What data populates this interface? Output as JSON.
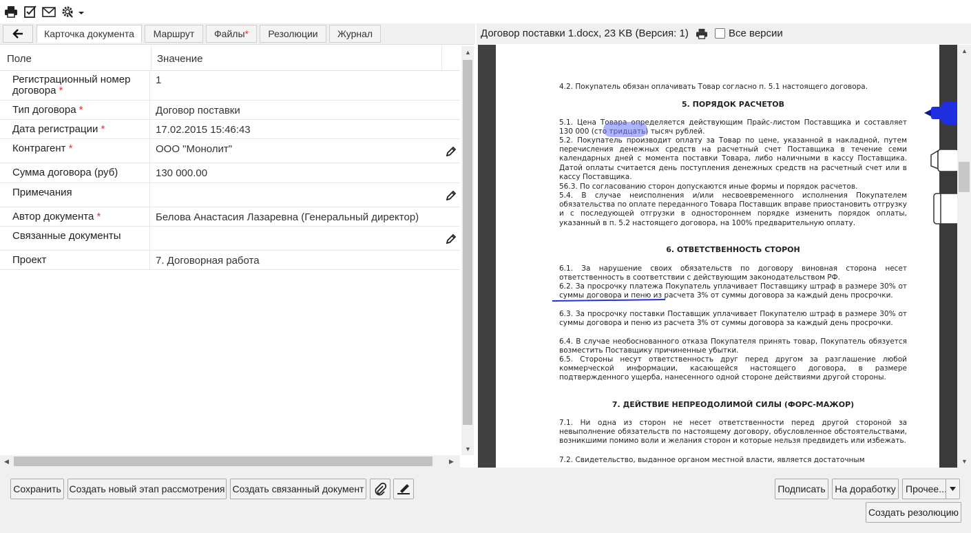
{
  "toolbar": {
    "icons": [
      "printer-icon",
      "checklist-icon",
      "envelope-icon",
      "gear-settings-icon",
      "chevron-down-icon"
    ]
  },
  "tabs": [
    {
      "label": "Карточка документа",
      "active": true
    },
    {
      "label": "Маршрут",
      "active": false
    },
    {
      "label": "Файлы",
      "marker": "*",
      "active": false
    },
    {
      "label": "Резолюции",
      "active": false
    },
    {
      "label": "Журнал",
      "active": false
    }
  ],
  "grid": {
    "col_field": "Поле",
    "col_value": "Значение",
    "rows": [
      {
        "field": "Регистрационный номер договора",
        "required": "*",
        "value": "1",
        "editable": false
      },
      {
        "field": "Тип договора",
        "required": "*",
        "value": "Договор поставки",
        "editable": false
      },
      {
        "field": "Дата регистрации",
        "required": "*",
        "value": "17.02.2015 15:46:43",
        "editable": false
      },
      {
        "field": "Контрагент",
        "required": "*",
        "value": "ООО \"Монолит\"",
        "editable": true
      },
      {
        "field": "Сумма договора (руб)",
        "required": "",
        "value": "130 000.00",
        "editable": false
      },
      {
        "field": "Примечания",
        "required": "",
        "value": "",
        "editable": true
      },
      {
        "field": "Автор документа",
        "required": "*",
        "value": "Белова Анастасия Лазаревна (Генеральный директор)",
        "editable": false
      },
      {
        "field": "Связанные документы",
        "required": "",
        "value": "",
        "editable": true
      },
      {
        "field": "Проект",
        "required": "",
        "value": "7. Договорная работа",
        "editable": false
      }
    ]
  },
  "document": {
    "title": "Договор поставки 1.docx, 23 KB (Версия: 1)",
    "all_versions_label": "Все версии",
    "all_versions_checked": false,
    "content": [
      {
        "type": "p",
        "text": "4.2. Покупатель обязан оплачивать Товар согласно п. 5.1 настоящего договора."
      },
      {
        "type": "h",
        "text": "5. ПОРЯДОК РАСЧЕТОВ"
      },
      {
        "type": "p",
        "text": "5.1. Цена Товара определяется действующим Прайс-листом Поставщика и составляет 130 000 (сто тридцать) тысяч рублей."
      },
      {
        "type": "p",
        "text": "5.2. Покупатель производит оплату за Товар по цене, указанной в накладной, путем перечисления денежных средств на расчетный счет Поставщика в течение семи календарных дней с момента поставки Товара, либо наличными в кассу Поставщика. Датой оплаты считается день поступления денежных средств на расчетный счет или в кассу Поставщика."
      },
      {
        "type": "p",
        "text": "56.3. По согласованию сторон допускаются иные формы и порядок расчетов."
      },
      {
        "type": "p",
        "text": "5.4. В случае неисполнения и/или несвоевременного исполнения Покупателем обязательства по оплате переданного Товара Поставщик вправе приостановить отгрузку и с последующей отгрузки в одностороннем порядке изменить порядок оплаты, указанный в п. 5.2 настоящего договора, на 100% предварительную оплату."
      },
      {
        "type": "h",
        "text": "6. ОТВЕТСТВЕННОСТЬ СТОРОН"
      },
      {
        "type": "p",
        "text": "6.1. За нарушение своих обязательств по договору виновная сторона несет ответственность в соответствии с действующим законодательством РФ."
      },
      {
        "type": "p",
        "text": "6.2. За просрочку платежа Покупатель уплачивает Поставщику штраф в размере 30% от суммы договора и пеню из расчета 3% от суммы договора за каждый день просрочки."
      },
      {
        "type": "p",
        "text": "6.3. За просрочку поставки Поставщик уплачивает Покупателю штраф в размере 30% от суммы договора и пеню из расчета 3% от суммы договора за каждый день просрочки."
      },
      {
        "type": "p",
        "text": "6.4. В случае необоснованного отказа Покупателя принять товар, Покупатель обязуется возместить Поставщику причиненные убытки."
      },
      {
        "type": "p",
        "text": "6.5. Стороны несут ответственность друг перед другом за разглашение любой коммерческой информации, касающейся настоящего договора, в размере подтвержденного ущерба, нанесенного одной стороне действиями другой стороны."
      },
      {
        "type": "h",
        "text": "7. ДЕЙСТВИЕ НЕПРЕОДОЛИМОЙ СИЛЫ (ФОРС-МАЖОР)"
      },
      {
        "type": "p",
        "text": "7.1. Ни одна из сторон не несет ответственности перед другой стороной за невыполнение обязательств по настоящему договору, обусловленное обстоятельствами, возникшими помимо воли и желания сторон и которые нельзя предвидеть или избежать."
      },
      {
        "type": "p",
        "text": "7.2. Свидетельство, выданное органом местной власти, является достаточным"
      }
    ],
    "annotation_tools": [
      "blue-marker-tool-icon",
      "white-highlighter-tool-icon",
      "eraser-tool-icon"
    ],
    "colors": {
      "marker": "#1f2fe0",
      "highlight": "#6f78ff"
    }
  },
  "buttons": {
    "save": "Сохранить",
    "new_stage": "Создать новый этап рассмотрения",
    "related_doc": "Создать связанный документ",
    "sign": "Подписать",
    "rework": "На доработку",
    "more": "Прочее...",
    "resolution": "Создать резолюцию"
  }
}
